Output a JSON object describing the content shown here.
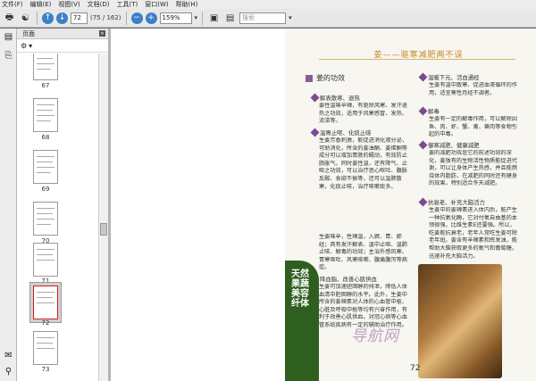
{
  "menubar": {
    "items": [
      "文件(F)",
      "编辑(E)",
      "视图(V)",
      "文档(D)",
      "工具(T)",
      "窗口(W)",
      "帮助(H)"
    ]
  },
  "toolbar": {
    "page_current": "72",
    "page_total": "(75 / 162)",
    "zoom": "159%",
    "search_placeholder": "搜索"
  },
  "sidebar": {
    "panel_title": "页面",
    "thumbnails": [
      "67",
      "68",
      "69",
      "70",
      "71",
      "72",
      "73"
    ],
    "selected": "72"
  },
  "document": {
    "title": "姜——驱寒减肥两不误",
    "section": "姜的功效",
    "vertical_band": "天然果蔬美容纤体",
    "page_number": "72",
    "watermark": "导航网",
    "col1": [
      {
        "bullet": "解表散寒、退热",
        "text": "姜性温味辛辣，有驱除风寒、发汗退热之功效，适用于风寒感冒、发热、流涕等。"
      },
      {
        "bullet": "温胃止呕、化痰止咳",
        "text": "生姜芳香刺激，能促进消化液分泌，可助消化，所含的姜油酮、姜烯酮等成分可以增加胃肠的蠕动，有效防止肠胀气，同时姜性温，还有降气、止呕之功效，可以治疗恶心呕吐、腹胀反酸、食欲不振等，还可以温肺散寒，化痰止咳，治疗咳嗽痰多。",
        "text2": "生姜味辛，性辣温，入脾、胃、肺经；具有发汗解表、温中止呕、温肺止咳、解毒的功效；主治外感风寒、胃寒呕吐、风寒咳嗽、腹痛腹泻等病症。"
      },
      {
        "bullet": "降血脂、改善心肌供血",
        "text": "生姜可加速胆固醇的排泄，降低人体血清中胆固醇的水平。此外，生姜中所含的姜辣素对人体的心血管中枢、心脏及呼吸中枢等均有兴奋作用，有利于改善心肌供血，对冠心病等心血管系统疾病有一定的辅助治疗作用。"
      }
    ],
    "col2": [
      {
        "bullet": "温暖下元、活血通经",
        "text": "生姜有温中散寒、促进血液循环的作用，适宜寒性月经不调者。"
      },
      {
        "bullet": "解毒",
        "text": "生姜有一定的解毒作用，可以解除因鱼、肉、虾、蟹、禽、兽肉等食物引起的中毒。"
      },
      {
        "bullet": "御寒减肥、健康减肥",
        "text": "姜的减肥功效是它的前述功效的深化，姜独有的生物活性物质能促进代谢，可以让身体产生热感，并且能燃烧体内脂肪，在减肥的同时还有健身的效果，特别适合冬天减肥。"
      },
      {
        "bullet": "抗衰老、补充大脑活力",
        "text": "生姜中的姜辣素进入体内后，能产生一种抗氧化酶，它对付氧自由基的本领很强，比维生素E还要强。所以，吃姜能抗衰老，老年人常吃生姜可除老年斑。姜含有辛辣素和挥发油，能帮助大脑获取更多的氧气和葡萄糖，迅速补充大脑活力。"
      }
    ]
  }
}
